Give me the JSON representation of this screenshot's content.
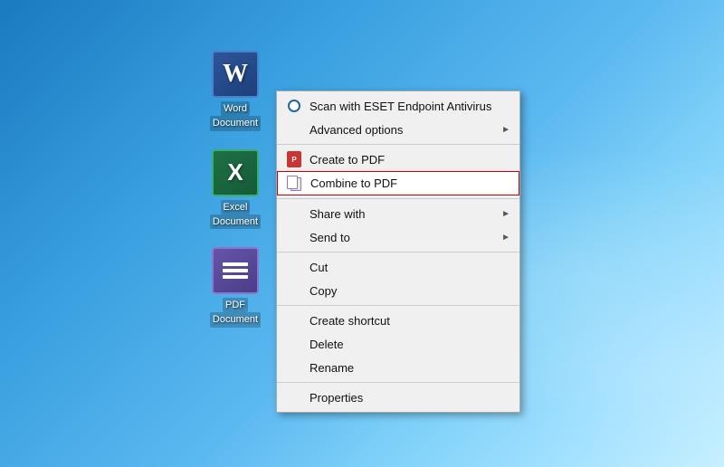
{
  "desktop": {
    "background": "Windows 7 Aero blue gradient"
  },
  "icons": [
    {
      "id": "word-doc",
      "type": "word",
      "label": "Word\nDocument",
      "label_line1": "Word",
      "label_line2": "Document"
    },
    {
      "id": "excel-doc",
      "type": "excel",
      "label": "Excel\nDocument",
      "label_line1": "Excel",
      "label_line2": "Document"
    },
    {
      "id": "pdf-doc",
      "type": "pdf",
      "label": "PDF\nDocument",
      "label_line1": "PDF",
      "label_line2": "Document"
    }
  ],
  "contextMenu": {
    "items": [
      {
        "id": "scan-eset",
        "label": "Scan with ESET Endpoint Antivirus",
        "hasArrow": false,
        "hasIcon": true,
        "iconType": "eset",
        "separator": false,
        "highlighted": false
      },
      {
        "id": "advanced-options",
        "label": "Advanced options",
        "hasArrow": true,
        "hasIcon": false,
        "separator": true,
        "highlighted": false
      },
      {
        "id": "create-pdf",
        "label": "Create to PDF",
        "hasArrow": false,
        "hasIcon": true,
        "iconType": "pdf",
        "separator": false,
        "highlighted": false
      },
      {
        "id": "combine-pdf",
        "label": "Combine to PDF",
        "hasArrow": false,
        "hasIcon": true,
        "iconType": "combine",
        "separator": true,
        "highlighted": true
      },
      {
        "id": "share-with",
        "label": "Share with",
        "hasArrow": true,
        "hasIcon": false,
        "separator": false,
        "highlighted": false
      },
      {
        "id": "send-to",
        "label": "Send to",
        "hasArrow": true,
        "hasIcon": false,
        "separator": true,
        "highlighted": false
      },
      {
        "id": "cut",
        "label": "Cut",
        "hasArrow": false,
        "hasIcon": false,
        "separator": false,
        "highlighted": false
      },
      {
        "id": "copy",
        "label": "Copy",
        "hasArrow": false,
        "hasIcon": false,
        "separator": true,
        "highlighted": false
      },
      {
        "id": "create-shortcut",
        "label": "Create shortcut",
        "hasArrow": false,
        "hasIcon": false,
        "separator": false,
        "highlighted": false
      },
      {
        "id": "delete",
        "label": "Delete",
        "hasArrow": false,
        "hasIcon": false,
        "separator": false,
        "highlighted": false
      },
      {
        "id": "rename",
        "label": "Rename",
        "hasArrow": false,
        "hasIcon": false,
        "separator": true,
        "highlighted": false
      },
      {
        "id": "properties",
        "label": "Properties",
        "hasArrow": false,
        "hasIcon": false,
        "separator": false,
        "highlighted": false
      }
    ]
  }
}
